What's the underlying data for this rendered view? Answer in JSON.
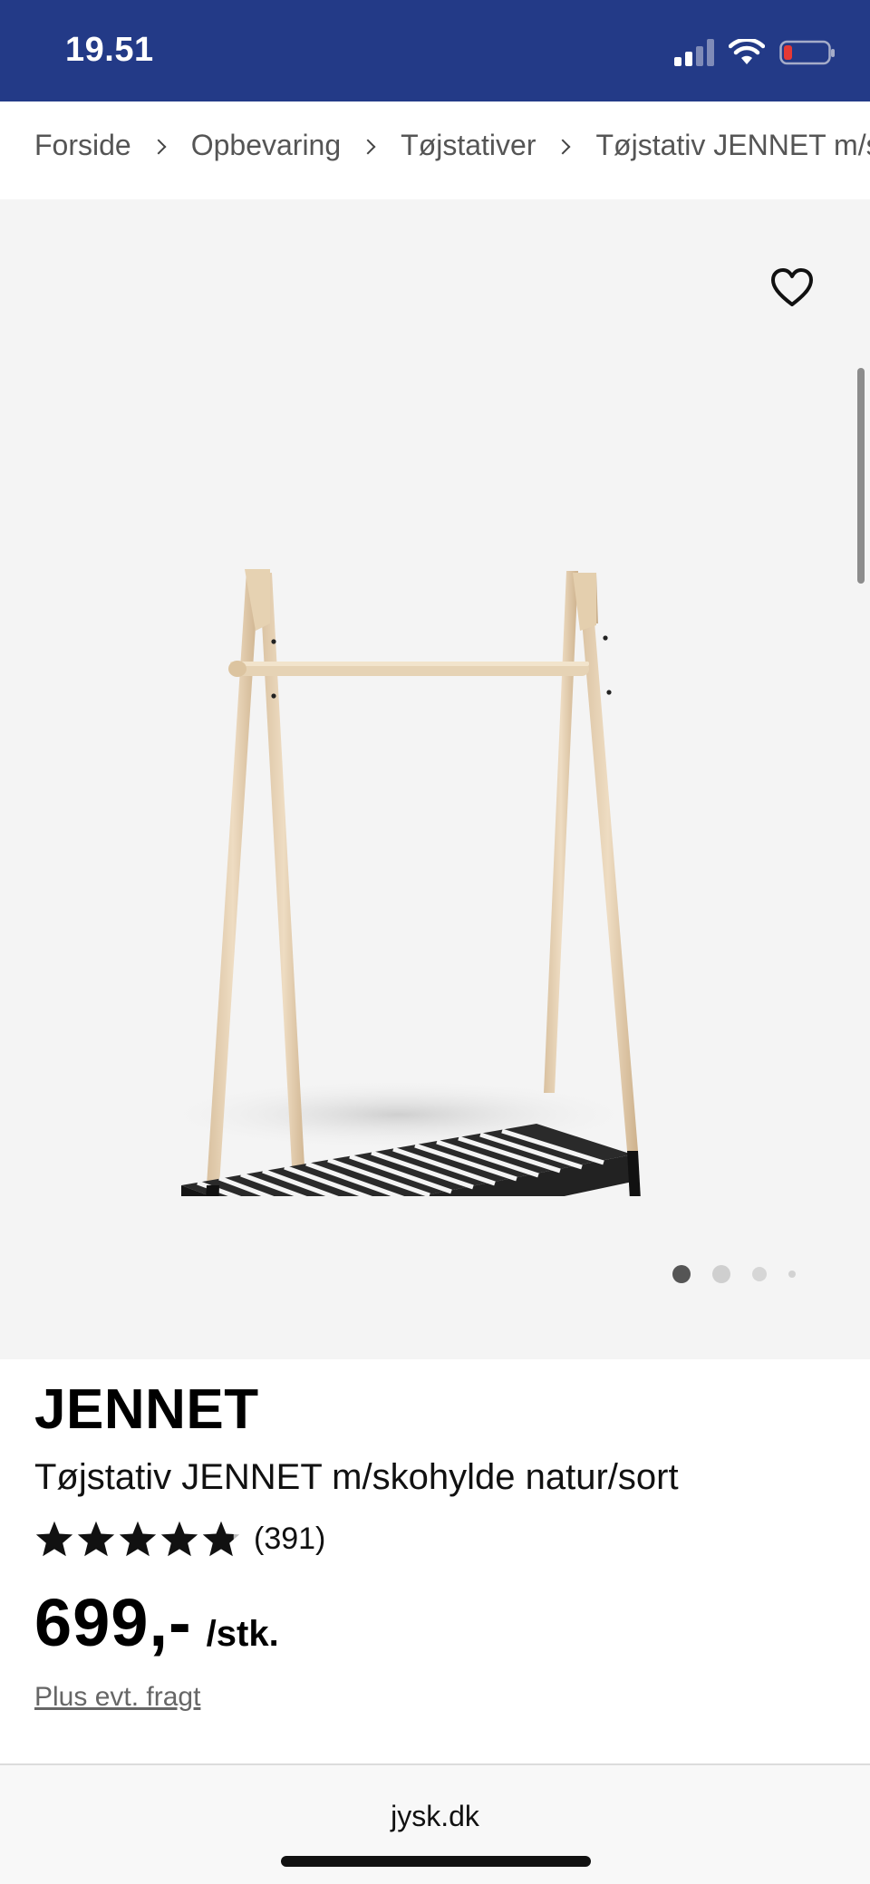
{
  "status_bar": {
    "time": "19.51",
    "icons": [
      "cellular-signal-icon",
      "wifi-icon",
      "battery-low-icon"
    ],
    "background": "#233a87"
  },
  "breadcrumb": {
    "items": [
      "Forside",
      "Opbevaring",
      "Tøjstativer",
      "Tøjstativ JENNET m/s"
    ]
  },
  "gallery": {
    "image": "clothes-rack-image",
    "favorite_icon": "heart-icon",
    "slide_count": 4,
    "active_slide": 1
  },
  "product": {
    "brand": "JENNET",
    "title": "Tøjstativ JENNET m/skohylde natur/sort",
    "rating": 4.8,
    "rating_max": 5,
    "review_count": "(391)",
    "price": "699,-",
    "price_unit": "/stk.",
    "freight_link": "Plus evt. fragt"
  },
  "browser": {
    "url": "jysk.dk"
  }
}
